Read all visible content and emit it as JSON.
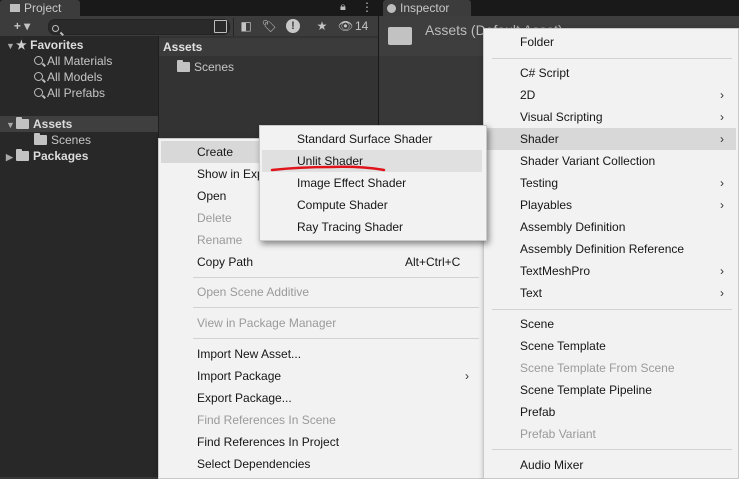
{
  "project": {
    "tab_label": "Project",
    "add_label": "+ ▾",
    "eye_count": "14",
    "favorites_label": "Favorites",
    "favorites": [
      "All Materials",
      "All Models",
      "All Prefabs"
    ],
    "assets_label": "Assets",
    "scenes_label": "Scenes",
    "packages_label": "Packages",
    "header": "Assets",
    "content_folder": "Scenes"
  },
  "inspector": {
    "tab_label": "Inspector",
    "title": "Assets (Default Asset)"
  },
  "context_menu": {
    "create": "Create",
    "show_in_explorer": "Show in Explorer",
    "open": "Open",
    "delete": "Delete",
    "rename": "Rename",
    "copy_path": "Copy Path",
    "copy_path_shortcut": "Alt+Ctrl+C",
    "open_scene_additive": "Open Scene Additive",
    "view_in_package_manager": "View in Package Manager",
    "import_new_asset": "Import New Asset...",
    "import_package": "Import Package",
    "export_package": "Export Package...",
    "find_refs_scene": "Find References In Scene",
    "find_refs_project": "Find References In Project",
    "select_dependencies": "Select Dependencies"
  },
  "create_menu": {
    "folder": "Folder",
    "csharp_script": "C# Script",
    "two_d": "2D",
    "visual_scripting": "Visual Scripting",
    "shader": "Shader",
    "shader_variant_collection": "Shader Variant Collection",
    "testing": "Testing",
    "playables": "Playables",
    "assembly_definition": "Assembly Definition",
    "assembly_definition_reference": "Assembly Definition Reference",
    "textmeshpro": "TextMeshPro",
    "text": "Text",
    "scene": "Scene",
    "scene_template": "Scene Template",
    "scene_template_from_scene": "Scene Template From Scene",
    "scene_template_pipeline": "Scene Template Pipeline",
    "prefab": "Prefab",
    "prefab_variant": "Prefab Variant",
    "audio_mixer": "Audio Mixer"
  },
  "shader_menu": {
    "items": [
      "Standard Surface Shader",
      "Unlit Shader",
      "Image Effect Shader",
      "Compute Shader",
      "Ray Tracing Shader"
    ],
    "annotation_color": "#e0141b"
  }
}
